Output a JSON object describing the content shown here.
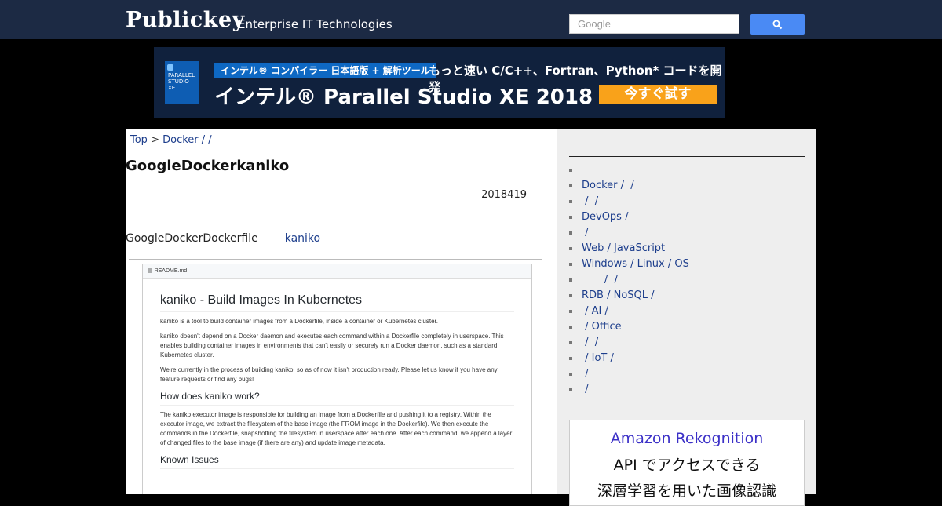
{
  "header": {
    "logo": "Publickey",
    "tagline": "Enterprise IT Technologies",
    "search_placeholder": "Google"
  },
  "banner": {
    "box_text": "PARALLEL STUDIO XE",
    "tag": "インテル® コンパイラー 日本語版 + 解析ツール",
    "subheadline": "もっと速い C/C++、Fortran、Python* コードを開発",
    "headline": "インテル® Parallel Studio XE 2018",
    "cta": "今すぐ試す"
  },
  "breadcrumb": {
    "top": "Top",
    "sep": " > ",
    "category": "Docker /  /"
  },
  "article": {
    "title": "GoogleDockerkaniko",
    "date": "2018419",
    "lead_text": "GoogleDockerDockerfile",
    "lead_link": "kaniko"
  },
  "screenshot": {
    "file": "README.md",
    "title": "kaniko - Build Images In Kubernetes",
    "p1": "kaniko is a tool to build container images from a Dockerfile, inside a container or Kubernetes cluster.",
    "p2": "kaniko doesn't depend on a Docker daemon and executes each command within a Dockerfile completely in userspace. This enables building container images in environments that can't easily or securely run a Docker daemon, such as a standard Kubernetes cluster.",
    "p3": "We're currently in the process of building kaniko, so as of now it isn't production ready. Please let us know if you have any feature requests or find any bugs!",
    "h2": "How does kaniko work?",
    "p4": "The kaniko executor image is responsible for building an image from a Dockerfile and pushing it to a registry. Within the executor image, we extract the filesystem of the base image (the FROM image in the Dockerfile). We then execute the commands in the Dockerfile, snapshotting the filesystem in userspace after each one. After each command, we append a layer of changed files to the base image (if there are any) and update image metadata.",
    "h3": "Known Issues"
  },
  "sidebar": {
    "items": [
      "",
      "Docker /  /",
      " /  /",
      "DevOps /",
      " /",
      "Web / JavaScript",
      "Windows / Linux / OS",
      "       /  /",
      "RDB / NoSQL /",
      " / AI /",
      " / Office",
      " /  /",
      " / IoT /",
      " /",
      " /"
    ]
  },
  "ad": {
    "line1": "Amazon Rekognition",
    "line2": "API でアクセスできる",
    "line3": "深層学習を用いた画像認識"
  }
}
